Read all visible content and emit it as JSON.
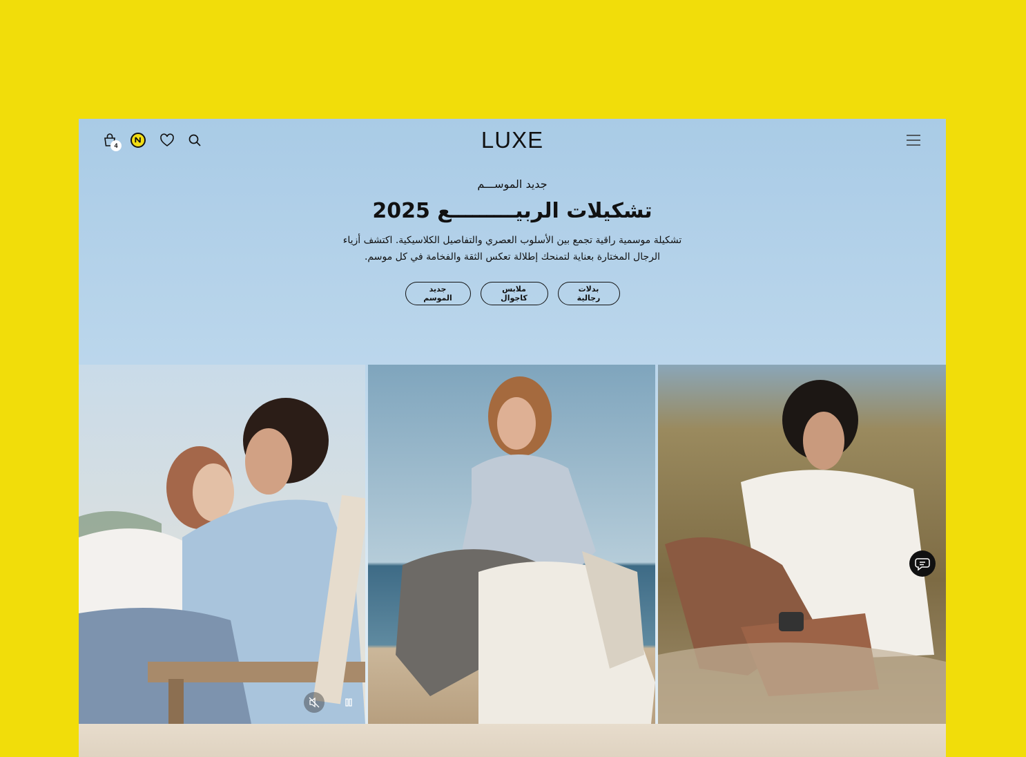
{
  "header": {
    "logo": "LUXE",
    "cart_count": "4",
    "icons": [
      "cart-icon",
      "language-icon",
      "heart-icon",
      "search-icon",
      "menu-icon"
    ]
  },
  "hero": {
    "eyebrow": "جديد الموســـم",
    "title": "تشكيلات الربيـــــــــع 2025",
    "description": "تشكيلة موسمية راقية تجمع بين الأسلوب العصري والتفاصيل الكلاسيكية. اكتشف أزياء الرجال المختارة بعناية لتمنحك إطلالة تعكس الثقة والفخامة في كل موسم.",
    "buttons": [
      "جديد الموسم",
      "ملابس كاجوال",
      "بدلات رجالية"
    ]
  },
  "media": {
    "controls": [
      "mute-icon",
      "pause-icon"
    ],
    "chat": "chat-icon"
  },
  "colors": {
    "page_background": "#f1dd0a",
    "sky": "#a9cbe6",
    "text": "#111111"
  }
}
